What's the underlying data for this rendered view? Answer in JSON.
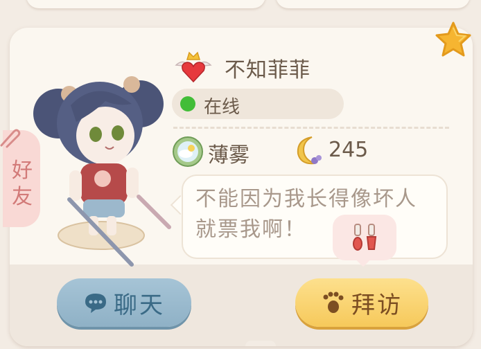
{
  "player": {
    "name": "不知菲菲",
    "status": "在线",
    "weather": "薄雾",
    "moon_count": "245",
    "message": "不能因为我长得像坏人就票我啊！"
  },
  "tag": {
    "friend": "好友"
  },
  "buttons": {
    "chat": "聊天",
    "visit": "拜访"
  },
  "colors": {
    "online": "#42bd38",
    "chat_button": "#9ebcd0",
    "visit_button": "#f8d06a",
    "friend_tag": "#f9d9d5"
  },
  "icons": [
    "star-icon",
    "heart-crown-icon",
    "weather-icon",
    "moon-icon",
    "chat-bubble-icon",
    "footprint-icon",
    "tools-icon",
    "paperclip-icon"
  ]
}
